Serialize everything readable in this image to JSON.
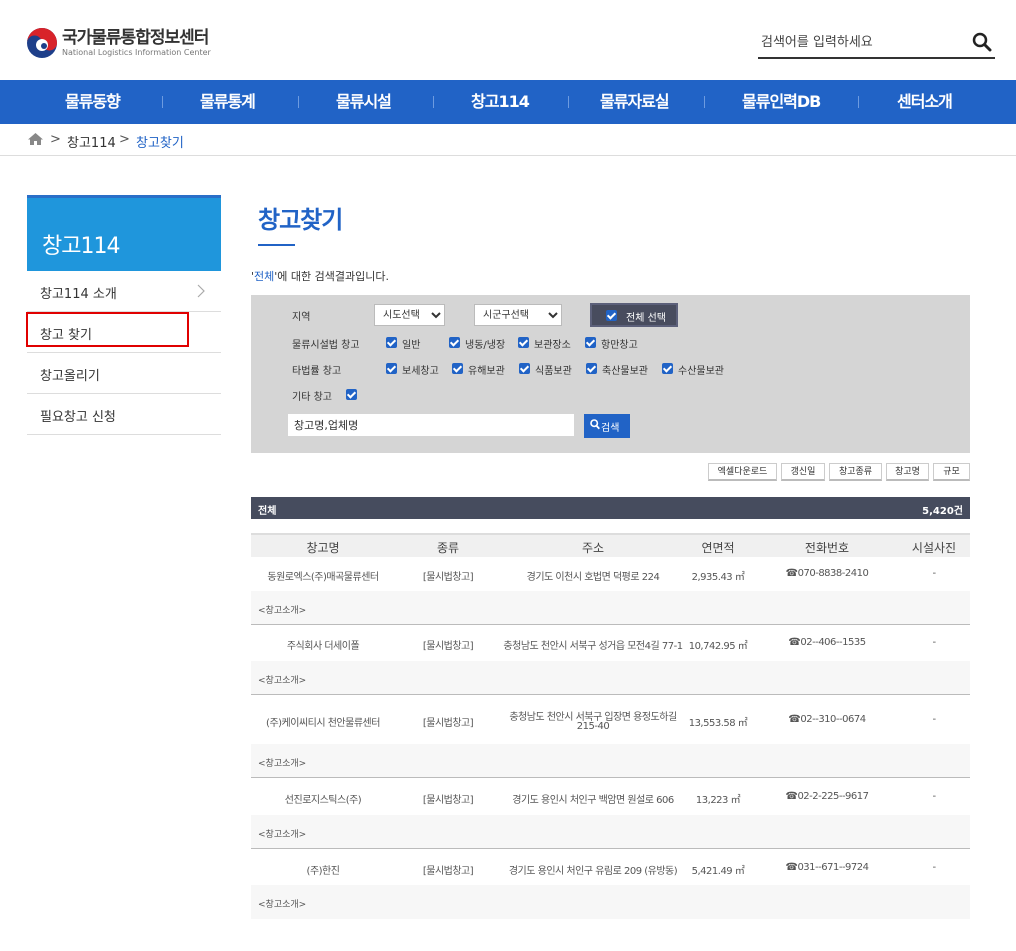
{
  "header": {
    "logo_ko": "국가물류통합정보센터",
    "logo_en": "National Logistics Information Center",
    "search_placeholder": "검색어를 입력하세요"
  },
  "gnb": [
    "물류동향",
    "물류통계",
    "물류시설",
    "창고114",
    "물류자료실",
    "물류인력DB",
    "센터소개"
  ],
  "breadcrumb": {
    "sep": ">",
    "items": [
      "창고114",
      "창고찾기"
    ]
  },
  "lnb": {
    "title": "창고114",
    "items": [
      "창고114 소개",
      "창고 찾기",
      "창고올리기",
      "필요창고 신청"
    ]
  },
  "page": {
    "title": "창고찾기",
    "result_prefix": "'",
    "result_keyword": "전체",
    "result_suffix": "'에 대한 검색결과입니다."
  },
  "filter": {
    "region_label": "지역",
    "sido": "시도선택",
    "sigungu": "시군구선택",
    "all_select": "전체 선택",
    "law_label": "물류시설법 창고",
    "law_items": [
      "일반",
      "냉동/냉장",
      "보관장소",
      "항만창고"
    ],
    "other_label": "타법률 창고",
    "other_items": [
      "보세창고",
      "유해보관",
      "식품보관",
      "축산물보관",
      "수산물보관"
    ],
    "etc_label": "기타 창고",
    "name_placeholder": "창고명,업체명",
    "search_btn": "검색"
  },
  "sort_buttons": [
    "엑셀다운로드",
    "갱신일",
    "창고종류",
    "창고명",
    "규모"
  ],
  "total": {
    "label": "전체",
    "count": "5,420건"
  },
  "table": {
    "headers": [
      "창고명",
      "종류",
      "주소",
      "연면적",
      "전화번호",
      "시설사진"
    ],
    "intro_label": "<창고소개>",
    "rows": [
      {
        "name": "동원로엑스(주)매곡물류센터",
        "type": "[물시법창고]",
        "addr": "경기도 이천시 호법면 덕평로 224",
        "addr2": "",
        "area": "2,935.43 ㎡",
        "tel": "☎070-8838-2410",
        "photo": "-"
      },
      {
        "name": "주식회사 더세이폴",
        "type": "[물시법창고]",
        "addr": "충청남도 천안시 서북구 성거읍 모전4길 77-1",
        "addr2": "",
        "area": "10,742.95 ㎡",
        "tel": "☎02--406--1535",
        "photo": "-"
      },
      {
        "name": "(주)케이씨티시 천안물류센터",
        "type": "[물시법창고]",
        "addr": "충청남도 천안시 서북구 입장면 용정도하길",
        "addr2": "215-40",
        "area": "13,553.58 ㎡",
        "tel": "☎02--310--0674",
        "photo": "-"
      },
      {
        "name": "선진로지스틱스(주)",
        "type": "[물시법창고]",
        "addr": "경기도 용인시 처인구 백암면 원설로 606",
        "addr2": "",
        "area": "13,223 ㎡",
        "tel": "☎02-2-225--9617",
        "photo": "-"
      },
      {
        "name": "(주)한진",
        "type": "[물시법창고]",
        "addr": "경기도 용인시 처인구 유림로 209 (유방동)",
        "addr2": "",
        "area": "5,421.49 ㎡",
        "tel": "☎031--671--9724",
        "photo": "-"
      }
    ]
  },
  "colors": {
    "brand_blue": "#2163c6",
    "lnb_blue": "#1f96dc",
    "highlight_red": "#e00000",
    "total_bar": "#464c5e"
  }
}
